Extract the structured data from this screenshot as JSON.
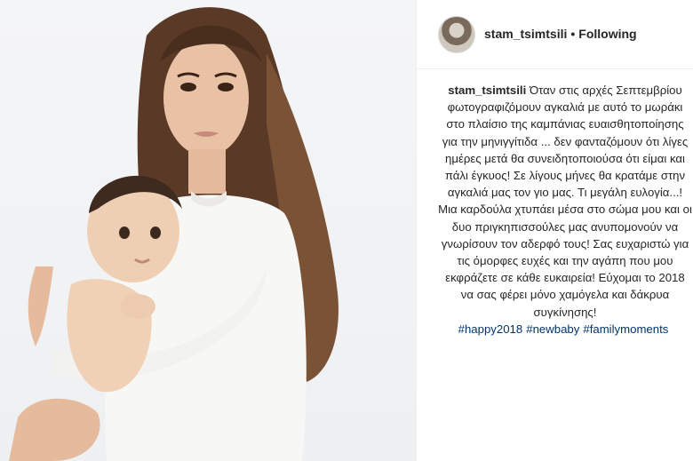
{
  "header": {
    "username": "stam_tsimtsili",
    "separator": "•",
    "follow_status": "Following"
  },
  "caption": {
    "username": "stam_tsimtsili",
    "text": "Όταν στις αρχές Σεπτεμβρίου φωτογραφιζόμουν αγκαλιά με αυτό το μωράκι στο πλαίσιο της καμπάνιας ευαισθητοποίησης για την μηνιγγίτιδα ... δεν φανταζόμουν ότι λίγες ημέρες μετά θα συνειδητοποιούσα ότι είμαι και πάλι έγκυος! Σε λίγους μήνες θα κρατάμε στην αγκαλιά μας τον γιο μας. Τι μεγάλη ευλογία...! Μια καρδούλα χτυπάει μέσα στο σώμα μου και οι δυο πριγκηπισσούλες μας ανυπομονούν να γνωρίσουν τον αδερφό τους! Σας ευχαριστώ για τις όμορφες ευχές και την αγάπη που μου εκφράζετε σε κάθε ευκαιρεία! Εύχομαι το 2018 να σας φέρει μόνο χαμόγελα και δάκρυα συγκίνησης!",
    "hashtags": [
      "#happy2018",
      "#newbaby",
      "#familymoments"
    ]
  },
  "colors": {
    "text": "#262626",
    "hashtag": "#003569",
    "divider": "#efefef"
  }
}
